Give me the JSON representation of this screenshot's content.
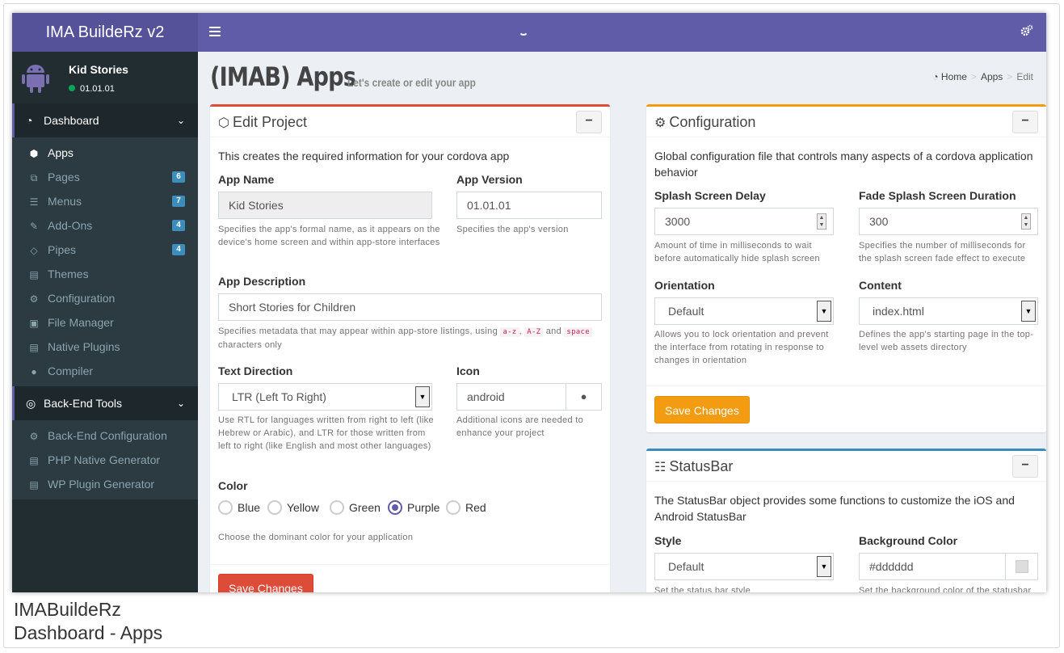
{
  "app": {
    "logo": "IMA BuildeRz v2"
  },
  "user": {
    "name": "Kid Stories",
    "status": "01.01.01"
  },
  "sidebar": {
    "dashboard": "Dashboard",
    "items": [
      {
        "label": "Apps",
        "icon": "cubes-icon",
        "glyph": "⬢"
      },
      {
        "label": "Pages",
        "icon": "files-icon",
        "glyph": "⧉",
        "badge": "6"
      },
      {
        "label": "Menus",
        "icon": "list-icon",
        "glyph": "☰",
        "badge": "7"
      },
      {
        "label": "Add-Ons",
        "icon": "magic-icon",
        "glyph": "✎",
        "badge": "4"
      },
      {
        "label": "Pipes",
        "icon": "code-icon",
        "glyph": "◇",
        "badge": "4"
      },
      {
        "label": "Themes",
        "icon": "file-code-icon",
        "glyph": "▤"
      },
      {
        "label": "Configuration",
        "icon": "cog-icon",
        "glyph": "⚙"
      },
      {
        "label": "File Manager",
        "icon": "image-icon",
        "glyph": "▣"
      },
      {
        "label": "Native Plugins",
        "icon": "file-code-icon",
        "glyph": "▤"
      },
      {
        "label": "Compiler",
        "icon": "android-icon",
        "glyph": "●"
      }
    ],
    "backend": "Back-End Tools",
    "backend_items": [
      {
        "label": "Back-End Configuration",
        "icon": "cog-icon",
        "glyph": "⚙"
      },
      {
        "label": "PHP Native Generator",
        "icon": "file-code-icon",
        "glyph": "▤"
      },
      {
        "label": "WP Plugin Generator",
        "icon": "file-code-icon",
        "glyph": "▤"
      }
    ]
  },
  "page": {
    "title": "(IMAB) Apps",
    "subtitle": "Let's create or edit your app"
  },
  "breadcrumb": {
    "home": "Home",
    "apps": "Apps",
    "current": "Edit",
    "sep": ">"
  },
  "edit": {
    "title": "Edit Project",
    "desc": "This creates the required information for your cordova app",
    "app_name_label": "App Name",
    "app_name_value": "Kid Stories",
    "app_name_help": "Specifies the app's formal name, as it appears on the device's home screen and within app-store interfaces",
    "app_version_label": "App Version",
    "app_version_value": "01.01.01",
    "app_version_help": "Specifies the app's version",
    "app_desc_label": "App Description",
    "app_desc_value": "Short Stories for Children",
    "app_desc_help_1": "Specifies metadata that may appear within app-store listings, using",
    "code_1": "a-z",
    "comma": ",",
    "code_2": "A-Z",
    "and": "and",
    "code_3": "space",
    "app_desc_help_2": "characters only",
    "text_dir_label": "Text Direction",
    "text_dir_value": "LTR (Left To Right)",
    "text_dir_help": "Use RTL for languages written from right to left (like Hebrew or Arabic), and LTR for those written from left to right (like English and most other languages)",
    "icon_label": "Icon",
    "icon_value": "android",
    "icon_help": "Additional icons are needed to enhance your project",
    "color_label": "Color",
    "colors": [
      "Blue",
      "Yellow",
      "Green",
      "Purple",
      "Red"
    ],
    "selected_color": "Purple",
    "color_help": "Choose the dominant color for your application",
    "save": "Save Changes",
    "collapse": "−"
  },
  "config": {
    "title": "Configuration",
    "desc": "Global configuration file that controls many aspects of a cordova application behavior",
    "splash_label": "Splash Screen Delay",
    "splash_value": "3000",
    "splash_help": "Amount of time in milliseconds to wait before automatically hide splash screen",
    "fade_label": "Fade Splash Screen Duration",
    "fade_value": "300",
    "fade_help": "Specifies the number of milliseconds for the splash screen fade effect to execute",
    "orient_label": "Orientation",
    "orient_value": "Default",
    "orient_help": "Allows you to lock orientation and prevent the interface from rotating in response to changes in orientation",
    "content_label": "Content",
    "content_value": "index.html",
    "content_help": "Defines the app's starting page in the top-level web assets directory",
    "save": "Save Changes",
    "collapse": "−"
  },
  "statusbar": {
    "title": "StatusBar",
    "desc": "The StatusBar object provides some functions to customize the iOS and Android StatusBar",
    "style_label": "Style",
    "style_value": "Default",
    "style_help": "Set the status bar style",
    "bg_label": "Background Color",
    "bg_value": "#dddddd",
    "bg_help": "Set the background color of the statusbar",
    "collapse": "−"
  },
  "caption": {
    "line1": "IMABuildeRz",
    "line2": "Dashboard - Apps"
  },
  "colors": {
    "brand": "#605ca8",
    "brand_dark": "#555299",
    "sidebar": "#222d32",
    "danger": "#dd4b39",
    "warning": "#f39c12",
    "info": "#3c8dbc"
  }
}
